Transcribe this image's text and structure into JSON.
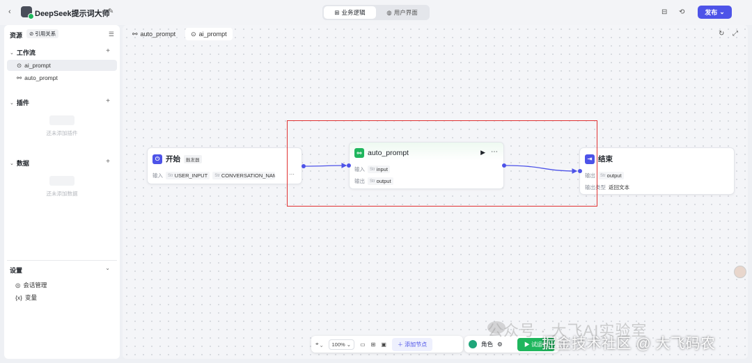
{
  "topbar": {
    "back": "‹",
    "title": "DeepSeek提示词大师",
    "tabs": [
      "业务逻辑",
      "用户界面"
    ],
    "publish": "发布"
  },
  "sidebar": {
    "resources": "资源",
    "references": "引用关系",
    "sections": {
      "workflow": "工作流",
      "plugins": "插件",
      "data": "数据",
      "settings": "设置"
    },
    "workflow_items": [
      "ai_prompt",
      "auto_prompt"
    ],
    "plugins_empty": "还未添加插件",
    "data_empty": "还未添加数据",
    "settings_items": [
      "会话管理",
      "变量"
    ],
    "settings_icon_var": "{x}"
  },
  "canvas": {
    "tabs": [
      "auto_prompt",
      "ai_prompt"
    ]
  },
  "nodes": {
    "start": {
      "title": "开始",
      "badge": "触发器",
      "input_label": "输入",
      "params": [
        "USER_INPUT",
        "CONVERSATION_NAME"
      ],
      "type_tag": "Str"
    },
    "middle": {
      "title": "auto_prompt",
      "input_label": "输入",
      "output_label": "输出",
      "input_param": "input",
      "output_param": "output",
      "type_tag": "Str"
    },
    "end": {
      "title": "结束",
      "output_label": "输出",
      "output_param": "output",
      "output_type_label": "输出类型",
      "output_type": "返回文本",
      "type_tag": "Str"
    }
  },
  "bottombar": {
    "zoom": "100%",
    "add_node": "添加节点",
    "role": "角色",
    "try_run": "试运行"
  },
  "watermark": {
    "line1": "公众号 · 大飞AI实验室",
    "line2": "掘金技术社区 @ 大飞码农"
  },
  "colors": {
    "accent": "#4d53e8",
    "run_green": "#1fb65d",
    "highlight_red": "#e03131"
  }
}
